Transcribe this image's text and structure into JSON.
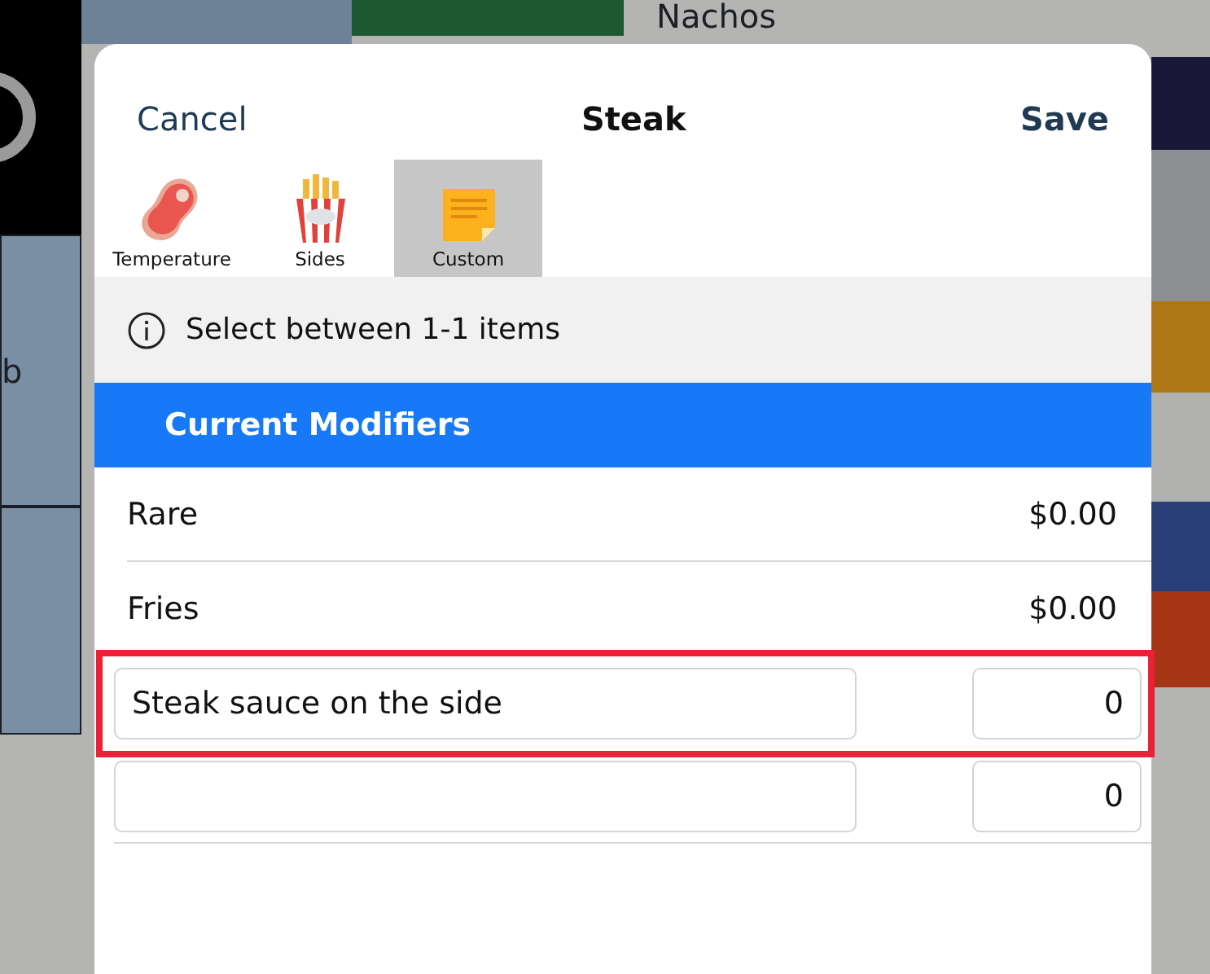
{
  "background_tiles": [
    {
      "text": "b"
    },
    {
      "text": "Nachos"
    }
  ],
  "dialog": {
    "cancel": "Cancel",
    "title": "Steak",
    "save": "Save",
    "tabs": [
      {
        "label": "Temperature",
        "kind": "steak",
        "selected": false
      },
      {
        "label": "Sides",
        "kind": "fries",
        "selected": false
      },
      {
        "label": "Custom",
        "kind": "note",
        "selected": true
      }
    ],
    "info": "Select between 1-1 items",
    "section_title": "Current Modifiers",
    "modifiers": [
      {
        "name": "Rare",
        "price": "$0.00"
      },
      {
        "name": "Fries",
        "price": "$0.00"
      }
    ],
    "custom_entries": [
      {
        "value": "Steak sauce on the side",
        "price": "0",
        "highlighted": true
      },
      {
        "price": "0",
        "highlighted": false
      }
    ]
  }
}
